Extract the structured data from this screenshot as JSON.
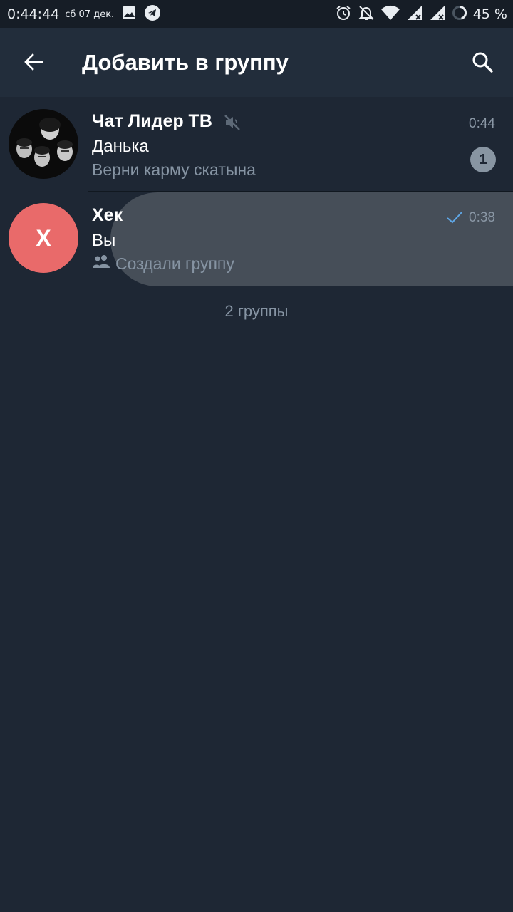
{
  "status_bar": {
    "time": "0:44:44",
    "date": "сб 07 дек.",
    "battery": "45 %",
    "icons": [
      "image-icon",
      "telegram-icon",
      "alarm-icon",
      "notifications-off-icon",
      "wifi-icon",
      "signal-icon",
      "signal-icon",
      "battery-ring-icon"
    ]
  },
  "app_bar": {
    "title": "Добавить в группу",
    "back_icon": "arrow-left-icon",
    "search_icon": "search-icon"
  },
  "chats": [
    {
      "name": "Чат Лидер ТВ",
      "muted": true,
      "time": "0:44",
      "sender": "Данька",
      "message": "Верни карму скатына",
      "unread": "1",
      "avatar": "group-photo"
    },
    {
      "name": "Хек",
      "avatar_letter": "Х",
      "avatar_color": "#e96a6a",
      "read_check": true,
      "time": "0:38",
      "sender": "Вы",
      "message": "Создали группу",
      "message_icon": "group-icon"
    }
  ],
  "footer": {
    "count_label": "2 группы"
  },
  "colors": {
    "background": "#1e2734",
    "app_bar": "#222d3b",
    "status_bar": "#161d26",
    "secondary_text": "#8694a3",
    "check": "#5fa7e6"
  }
}
